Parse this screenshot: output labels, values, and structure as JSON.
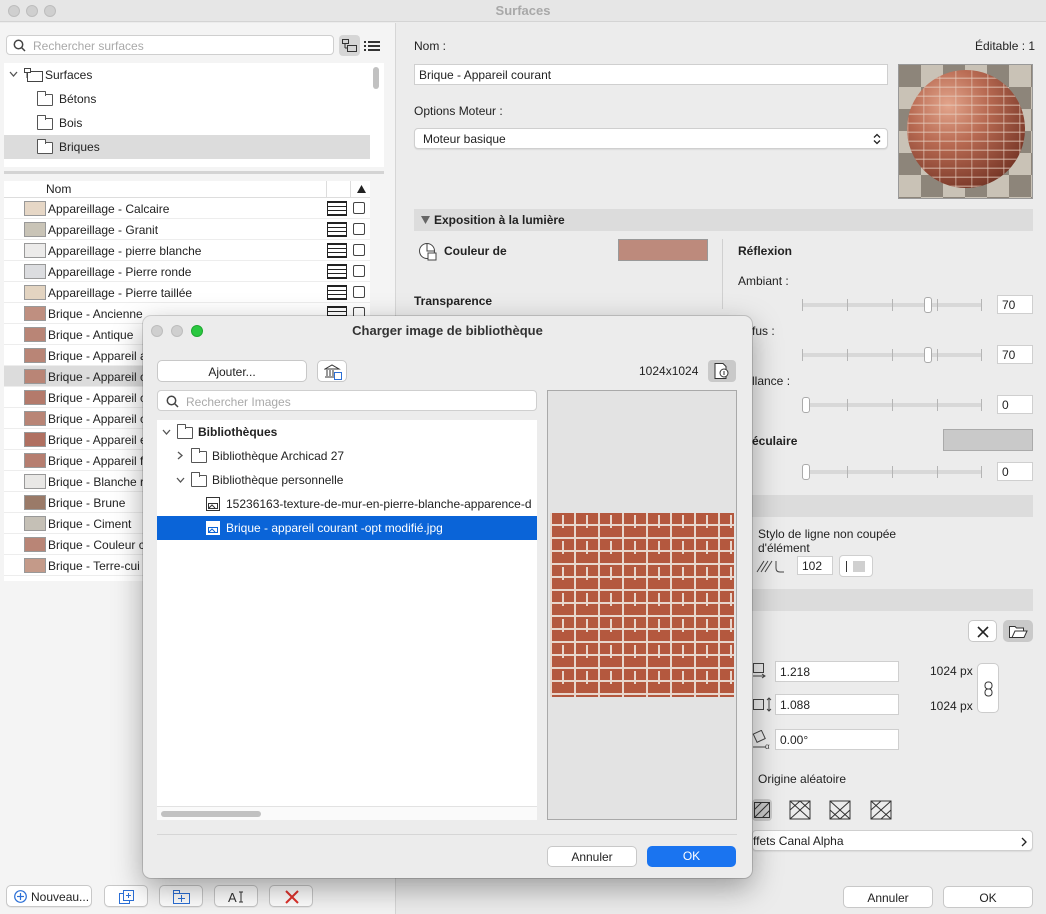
{
  "window": {
    "title": "Surfaces"
  },
  "left": {
    "search_placeholder": "Rechercher surfaces",
    "tree": [
      {
        "label": "Surfaces"
      },
      {
        "label": "Bétons"
      },
      {
        "label": "Bois"
      },
      {
        "label": "Briques"
      }
    ],
    "list_header": "Nom",
    "items": [
      {
        "name": "Appareillage - Calcaire",
        "color": "#e6d7c6"
      },
      {
        "name": "Appareillage - Granit",
        "color": "#c9c4b7"
      },
      {
        "name": "Appareillage - pierre blanche",
        "color": "#ecebea"
      },
      {
        "name": "Appareillage - Pierre ronde",
        "color": "#dcdde0"
      },
      {
        "name": "Appareillage - Pierre taillée",
        "color": "#e3d4c1"
      },
      {
        "name": "Brique - Ancienne",
        "color": "#bf8f80"
      },
      {
        "name": "Brique - Antique",
        "color": "#b98576"
      },
      {
        "name": "Brique - Appareil a",
        "color": "#b98576"
      },
      {
        "name": "Brique - Appareil c",
        "color": "#b98576"
      },
      {
        "name": "Brique - Appareil c",
        "color": "#b47a6b"
      },
      {
        "name": "Brique - Appareil c",
        "color": "#b98576"
      },
      {
        "name": "Brique - Appareil e",
        "color": "#b07061"
      },
      {
        "name": "Brique - Appareil f",
        "color": "#b67e70"
      },
      {
        "name": "Brique - Blanche r",
        "color": "#e9e8e6"
      },
      {
        "name": "Brique - Brune",
        "color": "#9a7a68"
      },
      {
        "name": "Brique - Ciment",
        "color": "#c5c0b6"
      },
      {
        "name": "Brique - Couleur c",
        "color": "#b98576"
      },
      {
        "name": "Brique - Terre-cui",
        "color": "#c49a89"
      }
    ],
    "new_button": "Nouveau..."
  },
  "right": {
    "name_label": "Nom :",
    "editable": "Éditable : 1",
    "name_value": "Brique - Appareil courant",
    "engine_label": "Options Moteur :",
    "engine_value": "Moteur basique",
    "exposure_section": "Exposition à la lumière",
    "color_label": "Couleur de",
    "surface_color": "#bd8a7c",
    "reflection_label": "Réflexion",
    "transparency_label": "Transparence",
    "ambient_label": "Ambiant :",
    "ambient_value": "70",
    "diffuse_label": "fus :",
    "diffuse_value": "70",
    "shine_label": "llance :",
    "shine_value": "0",
    "specular_label": "éculaire",
    "specular_value": "0",
    "line_style_label_1": "Stylo de ligne non coupée",
    "line_style_label_2": "d'élément",
    "pen_value": "102",
    "width_value": "1.218",
    "width_px": "1024 px",
    "height_value": "1.088",
    "height_px": "1024 px",
    "angle_value": "0.00°",
    "random_origin": "Origine aléatoire",
    "alpha_effects": "ffets Canal Alpha",
    "cancel": "Annuler",
    "ok": "OK"
  },
  "dialog": {
    "title": "Charger image de bibliothèque",
    "add_button": "Ajouter...",
    "dimensions": "1024x1024",
    "search_placeholder": "Rechercher Images",
    "tree": [
      {
        "label": "Bibliothèques"
      },
      {
        "label": "Bibliothèque Archicad 27"
      },
      {
        "label": "Bibliothèque personnelle"
      },
      {
        "label": "15236163-texture-de-mur-en-pierre-blanche-apparence-d"
      },
      {
        "label": "Brique - appareil courant -opt modifié.jpg"
      }
    ],
    "cancel": "Annuler",
    "ok": "OK"
  }
}
